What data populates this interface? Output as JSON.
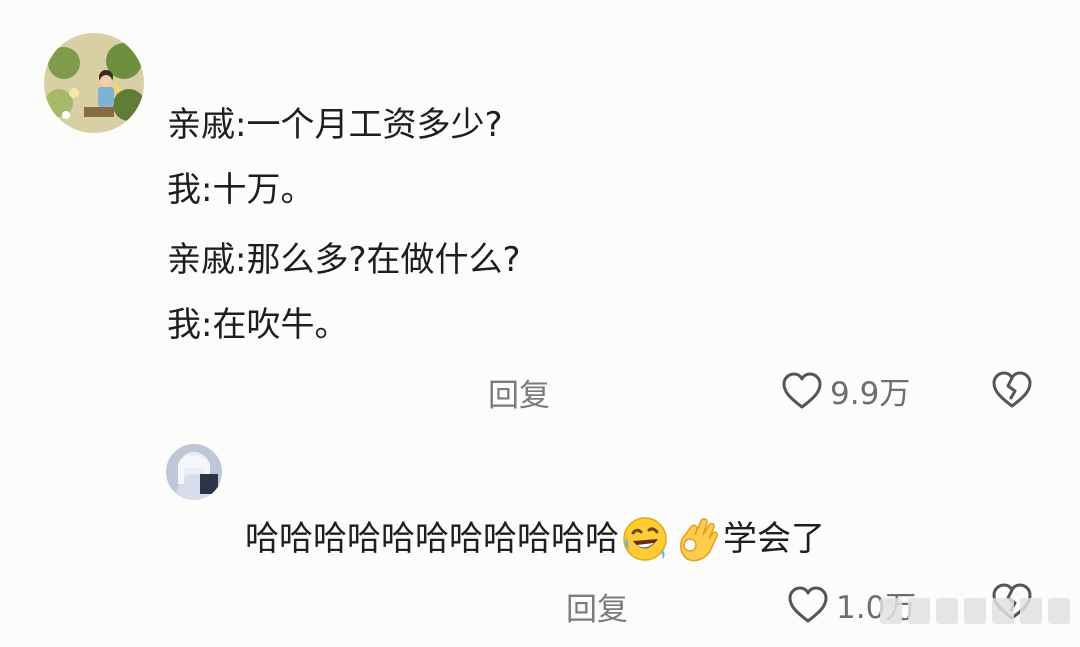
{
  "comment": {
    "author_avatar": "illustrated-boy-with-plants",
    "lines": [
      "亲戚:一个月工资多少?",
      "我:十万。",
      "亲戚:那么多?在做什么?",
      "我:在吹牛。"
    ],
    "reply_label": "回复",
    "likes": "9.9万",
    "like_icon": "heart-outline-icon",
    "dislike_icon": "broken-heart-icon"
  },
  "reply": {
    "author_avatar": "anime-girl-silver-hair",
    "text_prefix": "哈哈哈哈哈哈哈哈哈哈哈",
    "emojis": [
      "rolling-on-floor-laughing",
      "ok-hand"
    ],
    "text_suffix": "学会了",
    "reply_label": "回复",
    "likes": "1.0万"
  },
  "colors": {
    "background": "#fcfcfa",
    "text": "#1e1e1e",
    "muted": "#7b7b7b"
  }
}
